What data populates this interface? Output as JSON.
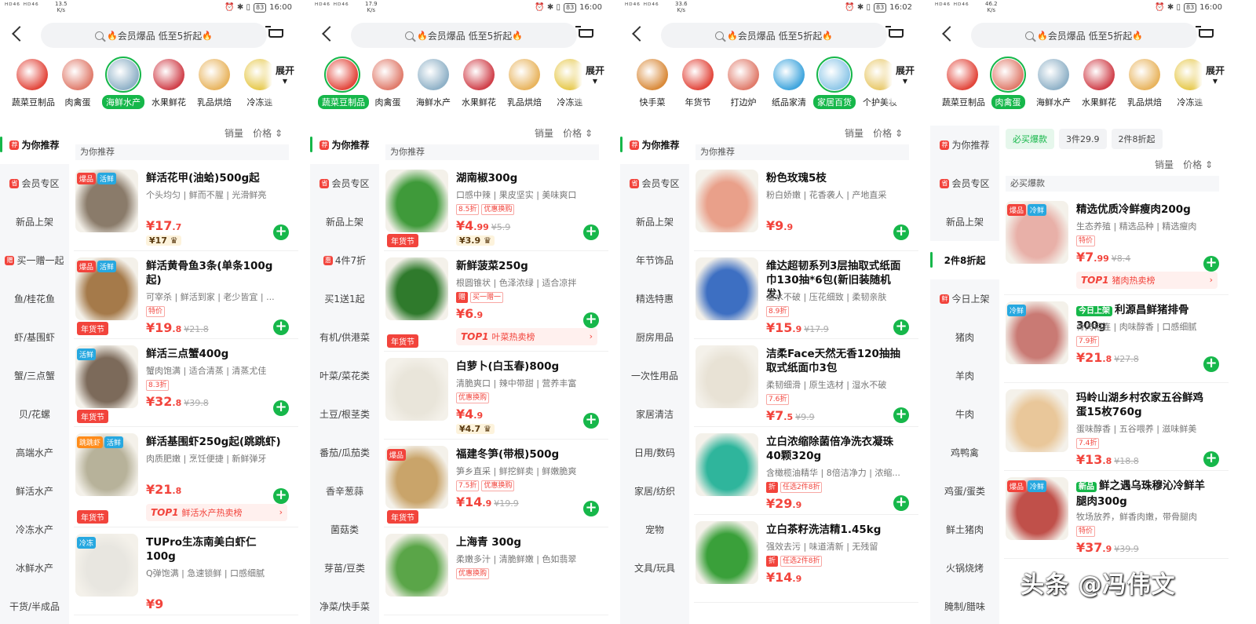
{
  "panels": [
    {
      "status": {
        "left": "ᴴᴰ⁴⁶ ᴴᴰ⁴⁶",
        "speed": "13.5",
        "speed_unit": "K/s",
        "battery": "83",
        "time": "16:00"
      },
      "search": {
        "placeholder": "会员爆品 低至5折起"
      },
      "categories": [
        {
          "label": "蔬菜豆制品",
          "color": "#e2463b"
        },
        {
          "label": "肉禽蛋",
          "color": "#e07b6b"
        },
        {
          "label": "海鲜水产",
          "color": "#8fb1c7"
        },
        {
          "label": "水果鲜花",
          "color": "#d0404a"
        },
        {
          "label": "乳品烘焙",
          "color": "#e8b45e"
        },
        {
          "label": "冷冻速",
          "color": "#e6c84a"
        }
      ],
      "selected_cat": 2,
      "expand": "展开",
      "sidebar": [
        {
          "label": "为你推荐",
          "icon": "荐",
          "active": true
        },
        {
          "label": "会员专区",
          "icon": "省"
        },
        {
          "label": "新品上架"
        },
        {
          "label": "买一赠一起",
          "icon": "赠"
        },
        {
          "label": "鱼/桂花鱼"
        },
        {
          "label": "虾/基围虾"
        },
        {
          "label": "蟹/三点蟹"
        },
        {
          "label": "贝/花螺"
        },
        {
          "label": "高端水产"
        },
        {
          "label": "鲜活水产"
        },
        {
          "label": "冷冻水产"
        },
        {
          "label": "冰鲜水产"
        },
        {
          "label": "干货/半成品"
        }
      ],
      "sort": {
        "sales": "销量",
        "price": "价格"
      },
      "section": "为你推荐",
      "products": [
        {
          "name": "鲜活花甲(油蛤)500g起",
          "desc": "个头均匀 | 鲜而不腥 | 光滑鲜亮",
          "badges": [
            {
              "t": "爆品",
              "c": "r"
            },
            {
              "t": "活鲜",
              "c": "c"
            }
          ],
          "price_int": "¥17",
          "price_dec": ".7",
          "vip": "¥17",
          "plus": "+",
          "img": "#8a7b6a"
        },
        {
          "name": "鲜活黄骨鱼3条(单条100g起)",
          "desc": "可宰杀 | 鲜活到家 | 老少皆宜 | ...",
          "badges": [
            {
              "t": "爆品",
              "c": "r"
            },
            {
              "t": "活鲜",
              "c": "c"
            }
          ],
          "tags": [
            "特价"
          ],
          "price_int": "¥19",
          "price_dec": ".8",
          "orig": "¥21.8",
          "nian": "年货节",
          "plus": "+",
          "img": "#a57a4a"
        },
        {
          "name": "鲜活三点蟹400g",
          "desc": "蟹肉饱满 | 适合清蒸 | 清蒸尤佳",
          "badges": [
            {
              "t": "活鲜",
              "c": "c"
            }
          ],
          "tags": [
            "8.3折"
          ],
          "price_int": "¥32",
          "price_dec": ".8",
          "orig": "¥39.8",
          "nian": "年货节",
          "plus": "+",
          "img": "#7c6a5a"
        },
        {
          "name": "鲜活基围虾250g起(跳跳虾)",
          "desc": "肉质肥嫩 | 烹饪便捷 | 新鲜弹牙",
          "badges": [
            {
              "t": "跳跳虾",
              "c": "o"
            },
            {
              "t": "活鲜",
              "c": "c"
            }
          ],
          "price_int": "¥21",
          "price_dec": ".8",
          "nian": "年货节",
          "top1": "鲜活水产热卖榜",
          "plus": "+",
          "img": "#b7b29a"
        },
        {
          "name": "TUPro生冻南美白虾仁100g",
          "desc": "Q弹饱满 | 急速锁鲜 | 口感细腻",
          "badges": [
            {
              "t": "冷冻",
              "c": "c"
            }
          ],
          "price_int": "¥9",
          "price_dec": "",
          "img": "#e8e6e0"
        }
      ]
    },
    {
      "status": {
        "left": "ᴴᴰ⁴⁶ ᴴᴰ⁴⁶",
        "speed": "17.9",
        "speed_unit": "K/s",
        "battery": "83",
        "time": "16:00"
      },
      "search": {
        "placeholder": "会员爆品 低至5折起"
      },
      "categories": [
        {
          "label": "蔬菜豆制品",
          "color": "#e2463b"
        },
        {
          "label": "肉禽蛋",
          "color": "#e07b6b"
        },
        {
          "label": "海鲜水产",
          "color": "#8fb1c7"
        },
        {
          "label": "水果鲜花",
          "color": "#d0404a"
        },
        {
          "label": "乳品烘焙",
          "color": "#e8b45e"
        },
        {
          "label": "冷冻速",
          "color": "#e6c84a"
        }
      ],
      "selected_cat": 0,
      "expand": "展开",
      "sidebar": [
        {
          "label": "为你推荐",
          "icon": "荐",
          "active": true
        },
        {
          "label": "会员专区",
          "icon": "省"
        },
        {
          "label": "新品上架"
        },
        {
          "label": "4件7折",
          "icon": "惠"
        },
        {
          "label": "买1送1起"
        },
        {
          "label": "有机/供港菜"
        },
        {
          "label": "叶菜/菜花类"
        },
        {
          "label": "土豆/根茎类"
        },
        {
          "label": "番茄/瓜茄类"
        },
        {
          "label": "香辛葱蒜"
        },
        {
          "label": "菌菇类"
        },
        {
          "label": "芽苗/豆类"
        },
        {
          "label": "净菜/快手菜"
        }
      ],
      "sort": {
        "sales": "销量",
        "price": "价格"
      },
      "section": "为你推荐",
      "products": [
        {
          "name": "湖南椒300g",
          "desc": "口感中辣 | 果皮坚实 | 美味爽口",
          "tags": [
            "8.5折",
            "优惠换购"
          ],
          "price_int": "¥4",
          "price_dec": ".99",
          "orig": "¥5.9",
          "vip": "¥3.9",
          "nian": "年货节",
          "plus": "+",
          "img": "#3f9a3a"
        },
        {
          "name": "新鲜菠菜250g",
          "desc": "根圆锥状 | 色泽浓绿 | 适合凉拌",
          "tags": [
            "买一赠一"
          ],
          "tagf": "赠",
          "price_int": "¥6",
          "price_dec": ".9",
          "nian": "年货节",
          "top1": "叶菜热卖榜",
          "plus": "+",
          "img": "#2f7a2c"
        },
        {
          "name": "白萝卜(白玉春)800g",
          "desc": "清脆爽口 | 辣中带甜 | 营养丰富",
          "tags": [
            "优惠换购"
          ],
          "price_int": "¥4",
          "price_dec": ".9",
          "vip": "¥4.7",
          "plus": "+",
          "img": "#e9e5da"
        },
        {
          "name": "福建冬笋(带根)500g",
          "desc": "笋乡直采 | 鲜挖鲜卖 | 鲜嫩脆爽",
          "badges": [
            {
              "t": "爆品",
              "c": "r"
            }
          ],
          "tags": [
            "7.5折",
            "优惠换购"
          ],
          "price_int": "¥14",
          "price_dec": ".9",
          "orig": "¥19.9",
          "nian": "年货节",
          "plus": "+",
          "img": "#c9a46a"
        },
        {
          "name": "上海青 300g",
          "desc": "柔嫩多汁 | 清脆鲜嫩 | 色如翡翠",
          "tags": [
            "优惠换购"
          ],
          "price_int": "",
          "price_dec": "",
          "img": "#5aa548"
        }
      ]
    },
    {
      "status": {
        "left": "ᴴᴰ⁴⁶ ᴴᴰ⁴⁶",
        "speed": "33.6",
        "speed_unit": "K/s",
        "battery": "83",
        "time": "16:02"
      },
      "search": {
        "placeholder": "会员爆品 低至5折起"
      },
      "categories": [
        {
          "label": "快手菜",
          "color": "#d98a3a"
        },
        {
          "label": "年货节",
          "color": "#e2463b"
        },
        {
          "label": "打边炉",
          "color": "#e07b6b"
        },
        {
          "label": "纸品家清",
          "color": "#3fa5dd"
        },
        {
          "label": "家居百货",
          "color": "#8ec7e8"
        },
        {
          "label": "个护美妆",
          "color": "#e8c868"
        }
      ],
      "selected_cat": 4,
      "expand": "展开",
      "sidebar": [
        {
          "label": "为你推荐",
          "icon": "荐",
          "active": true
        },
        {
          "label": "会员专区",
          "icon": "省"
        },
        {
          "label": "新品上架"
        },
        {
          "label": "年节饰品"
        },
        {
          "label": "精选特惠"
        },
        {
          "label": "厨房用品"
        },
        {
          "label": "一次性用品"
        },
        {
          "label": "家居清洁"
        },
        {
          "label": "日用/数码"
        },
        {
          "label": "家居/纺织"
        },
        {
          "label": "宠物"
        },
        {
          "label": "文具/玩具"
        }
      ],
      "sort": {
        "sales": "销量",
        "price": "价格"
      },
      "section": "为你推荐",
      "products": [
        {
          "name": "粉色玫瑰5枝",
          "desc": "粉白娇嫩 | 花香袭人 | 产地直采",
          "price_int": "¥9",
          "price_dec": ".9",
          "plus": "+",
          "img": "#e9a08a"
        },
        {
          "name": "维达超韧系列3层抽取式纸面巾130抽*6包(新旧装随机发)",
          "desc": "湿水不破 | 压花细致 | 柔韧亲肤",
          "tags": [
            "8.9折"
          ],
          "price_int": "¥15",
          "price_dec": ".9",
          "orig": "¥17.9",
          "plus": "+",
          "img": "#3d6fc2"
        },
        {
          "name": "洁柔Face天然无香120抽抽取式纸面巾3包",
          "desc": "柔韧细滑 | 原生选材 | 湿水不破",
          "tags": [
            "7.6折"
          ],
          "price_int": "¥7",
          "price_dec": ".5",
          "orig": "¥9.9",
          "plus": "+",
          "img": "#e8e2d5"
        },
        {
          "name": "立白浓缩除菌倍净洗衣凝珠40颗320g",
          "desc": "含橄榄油精华 | 8倍洁净力 | 浓缩...",
          "tags": [
            "任选2件8折"
          ],
          "tagf": "折",
          "price_int": "¥29",
          "price_dec": ".9",
          "plus": "+",
          "img": "#2fb59c"
        },
        {
          "name": "立白茶籽洗洁精1.45kg",
          "desc": "强效去污 | 味道清新 | 无残留",
          "tags": [
            "任选2件8折"
          ],
          "tagf": "折",
          "price_int": "¥14",
          "price_dec": ".9",
          "img": "#3aa03a"
        }
      ]
    },
    {
      "status": {
        "left": "ᴴᴰ⁴⁶ ᴴᴰ⁴⁶",
        "speed": "46.2",
        "speed_unit": "K/s",
        "battery": "83",
        "time": "16:00"
      },
      "search": {
        "placeholder": "会员爆品 低至5折起"
      },
      "categories": [
        {
          "label": "蔬菜豆制品",
          "color": "#e2463b"
        },
        {
          "label": "肉禽蛋",
          "color": "#e07b6b"
        },
        {
          "label": "海鲜水产",
          "color": "#8fb1c7"
        },
        {
          "label": "水果鲜花",
          "color": "#d0404a"
        },
        {
          "label": "乳品烘焙",
          "color": "#e8b45e"
        },
        {
          "label": "冷冻速",
          "color": "#e6c84a"
        }
      ],
      "selected_cat": 1,
      "expand": "展开",
      "sidebar": [
        {
          "label": "为你推荐",
          "icon": "荐"
        },
        {
          "label": "会员专区",
          "icon": "省"
        },
        {
          "label": "新品上架"
        },
        {
          "label": "2件8折起",
          "active": true
        },
        {
          "label": "今日上架",
          "icon": "鲜"
        },
        {
          "label": "猪肉"
        },
        {
          "label": "羊肉"
        },
        {
          "label": "牛肉"
        },
        {
          "label": "鸡鸭禽"
        },
        {
          "label": "鸡蛋/蛋类"
        },
        {
          "label": "鲜土猪肉"
        },
        {
          "label": "火锅烧烤"
        },
        {
          "label": "腌制/腊味"
        }
      ],
      "filters": [
        "必买爆款",
        "3件29.9",
        "2件8折起"
      ],
      "sort": {
        "sales": "销量",
        "price": "价格"
      },
      "section": "必买爆款",
      "products": [
        {
          "name": "精选优质冷鲜瘦肉200g",
          "desc": "生态养殖 | 精选品种 | 精选瘦肉",
          "badges": [
            {
              "t": "爆品",
              "c": "r"
            },
            {
              "t": "冷鲜",
              "c": "c"
            }
          ],
          "tags": [
            "特价"
          ],
          "price_int": "¥7",
          "price_dec": ".99",
          "orig": "¥8.4",
          "top1": "猪肉热卖榜",
          "plus": "+",
          "img": "#e8b0a8"
        },
        {
          "name": "利源昌鲜猪排骨300g",
          "prefix": "今日上架",
          "desc": "骨肉相连 | 肉味醇香 | 口感细腻",
          "badges": [
            {
              "t": "冷鲜",
              "c": "c"
            }
          ],
          "tags": [
            "7.9折"
          ],
          "price_int": "¥21",
          "price_dec": ".8",
          "orig": "¥27.8",
          "plus": "+",
          "img": "#c97a74"
        },
        {
          "name": "玛岭山湖乡村农家五谷鲜鸡蛋15枚760g",
          "desc": "蛋味醇香 | 五谷喂养 | 滋味鲜美",
          "tags": [
            "7.4折"
          ],
          "price_int": "¥13",
          "price_dec": ".8",
          "orig": "¥18.8",
          "plus": "+",
          "img": "#e9c79a"
        },
        {
          "name": "鲜之遇乌珠穆沁冷鲜羊腿肉300g",
          "prefix": "新品",
          "desc": "牧场放养，鲜香肉嫩，带骨腿肉",
          "badges": [
            {
              "t": "爆品",
              "c": "r"
            },
            {
              "t": "冷鲜",
              "c": "c"
            }
          ],
          "tags": [
            "特价"
          ],
          "price_int": "¥37",
          "price_dec": ".9",
          "orig": "¥39.9",
          "img": "#c0504a"
        }
      ]
    }
  ],
  "watermark": "头条 @冯伟文"
}
